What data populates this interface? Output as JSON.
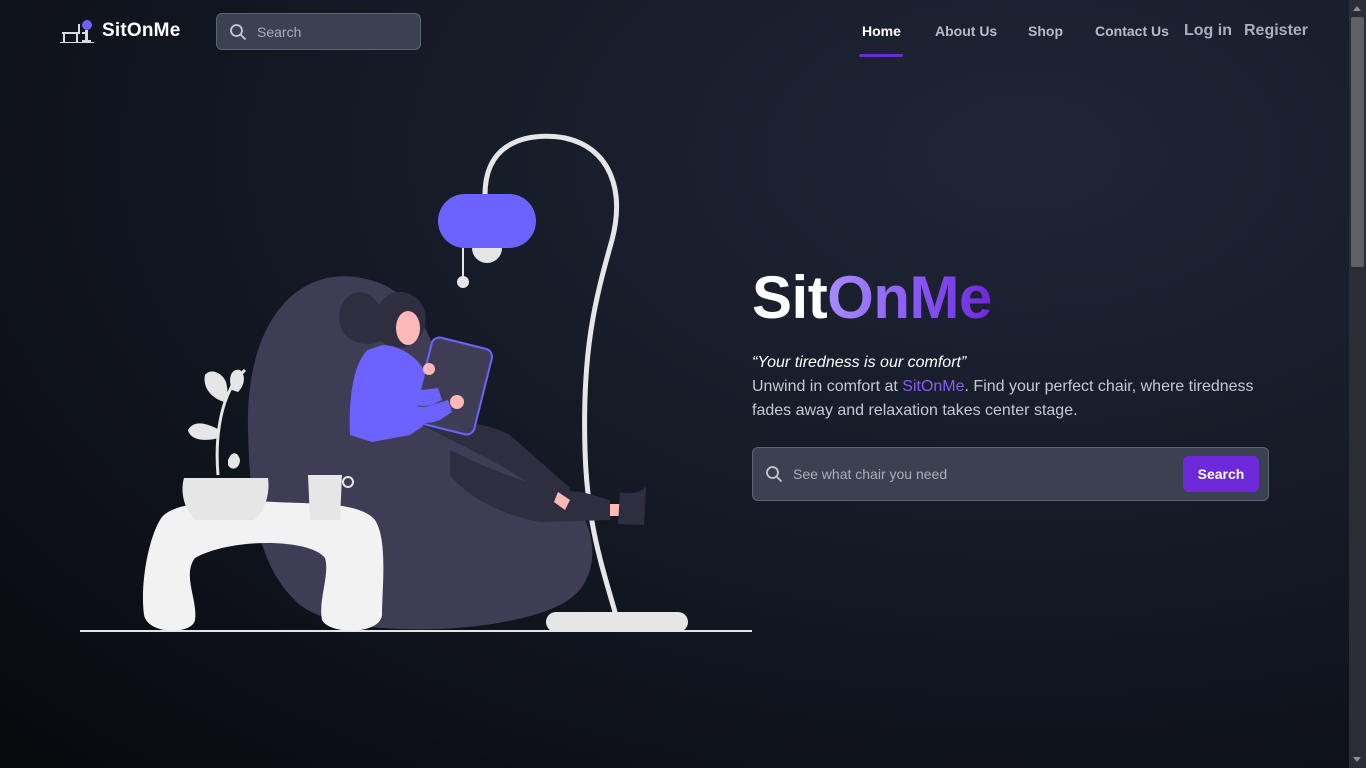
{
  "brand": {
    "name": "SitOnMe",
    "logo_icon": "chair-logo-icon"
  },
  "nav_search": {
    "placeholder": "Search",
    "icon": "search-icon"
  },
  "nav": {
    "links": [
      {
        "label": "Home",
        "active": true
      },
      {
        "label": "About Us",
        "active": false
      },
      {
        "label": "Shop",
        "active": false
      },
      {
        "label": "Contact Us",
        "active": false
      }
    ],
    "login_label": "Log in",
    "register_label": "Register"
  },
  "hero": {
    "title_part1": "Sit",
    "title_part2": "OnMe",
    "tagline": "“Your tiredness is our comfort”",
    "desc_before": "Unwind in comfort at ",
    "desc_brand": "SitOnMe",
    "desc_after": ". Find your perfect chair, where tiredness fades away and relaxation takes center stage.",
    "search_placeholder": "See what chair you need",
    "search_button": "Search"
  },
  "colors": {
    "accent": "#6d28d9",
    "accent_light": "#a78bfa",
    "lamp_shade": "#6c63ff",
    "beanbag": "#3f3d56",
    "background_dark": "#07090d",
    "background_mid": "#1f2536"
  }
}
